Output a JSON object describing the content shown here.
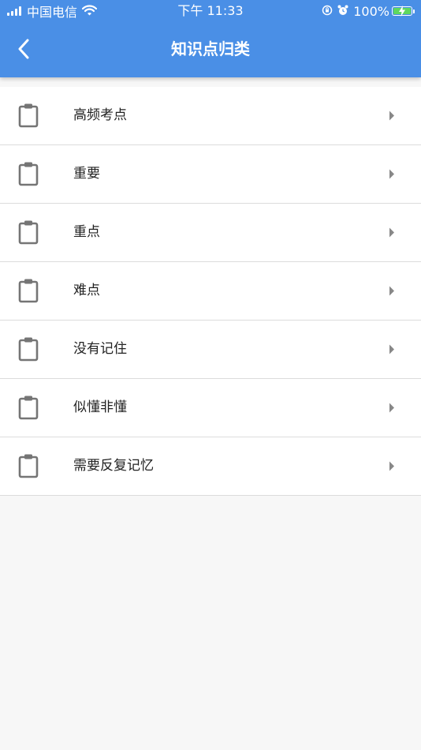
{
  "status_bar": {
    "carrier": "中国电信",
    "time": "下午 11:33",
    "battery": "100%"
  },
  "header": {
    "title": "知识点归类"
  },
  "list": {
    "items": [
      {
        "label": "高频考点"
      },
      {
        "label": "重要"
      },
      {
        "label": "重点"
      },
      {
        "label": "难点"
      },
      {
        "label": "没有记住"
      },
      {
        "label": "似懂非懂"
      },
      {
        "label": "需要反复记忆"
      }
    ]
  },
  "colors": {
    "header_bg": "#4a8fe6",
    "page_bg": "#f7f7f7",
    "icon_gray": "#757575",
    "chevron_gray": "#888888"
  },
  "icons": {
    "item": "clipboard-icon",
    "trailing": "chevron-right-icon",
    "back": "back-arrow-icon"
  }
}
